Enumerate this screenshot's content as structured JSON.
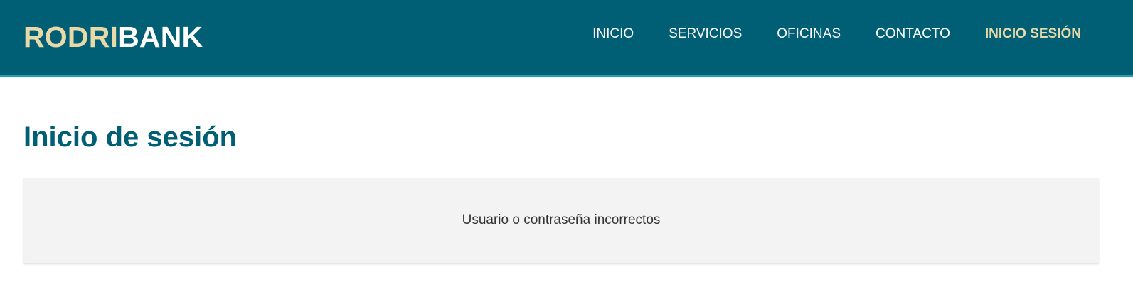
{
  "header": {
    "logo": {
      "part1": "RODRI",
      "part2": "BANK"
    },
    "nav": [
      {
        "label": "INICIO"
      },
      {
        "label": "SERVICIOS"
      },
      {
        "label": "OFICINAS"
      },
      {
        "label": "CONTACTO"
      },
      {
        "label": "INICIO SESIÓN",
        "active": true
      }
    ]
  },
  "main": {
    "title": "Inicio de sesión",
    "message": "Usuario o contraseña incorrectos"
  },
  "colors": {
    "header_bg": "#015f75",
    "header_accent_border": "#1aa3ad",
    "logo_accent": "#ead9a8",
    "active_nav": "#ead9a8",
    "title": "#015f75",
    "message_box_bg": "#f3f3f3"
  }
}
